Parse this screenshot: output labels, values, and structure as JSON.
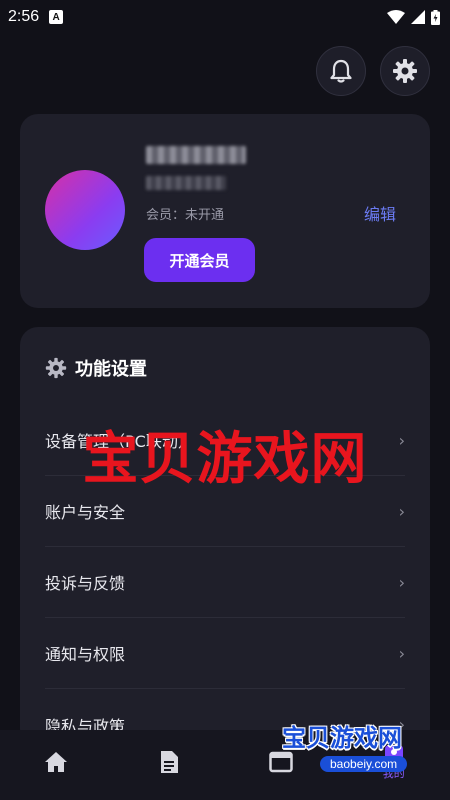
{
  "status_bar": {
    "time": "2:56",
    "notif_letter": "A"
  },
  "profile": {
    "member_status": "会员：未开通",
    "edit_label": "编辑",
    "open_vip_label": "开通会员",
    "avatar_gradient": [
      "#d630a6",
      "#6a5cff"
    ]
  },
  "settings": {
    "title": "功能设置",
    "items": [
      {
        "label": "设备管理（PC联动）"
      },
      {
        "label": "账户与安全"
      },
      {
        "label": "投诉与反馈"
      },
      {
        "label": "通知与权限"
      },
      {
        "label": "隐私与政策"
      }
    ]
  },
  "bottom_nav": {
    "items": [
      {
        "icon": "home-icon",
        "label": ""
      },
      {
        "icon": "document-icon",
        "label": ""
      },
      {
        "icon": "window-icon",
        "label": ""
      },
      {
        "icon": "profile-icon",
        "label": "我的"
      }
    ],
    "active_index": 3
  },
  "watermark": {
    "text": "宝贝游戏网",
    "logo_text": "宝贝游戏网",
    "logo_url": "baobeiy.com"
  },
  "colors": {
    "accent": "#6c2ff0",
    "link": "#6b7bf2",
    "background": "#111118",
    "card": "#1f1f2a",
    "watermark": "#e8151e"
  }
}
